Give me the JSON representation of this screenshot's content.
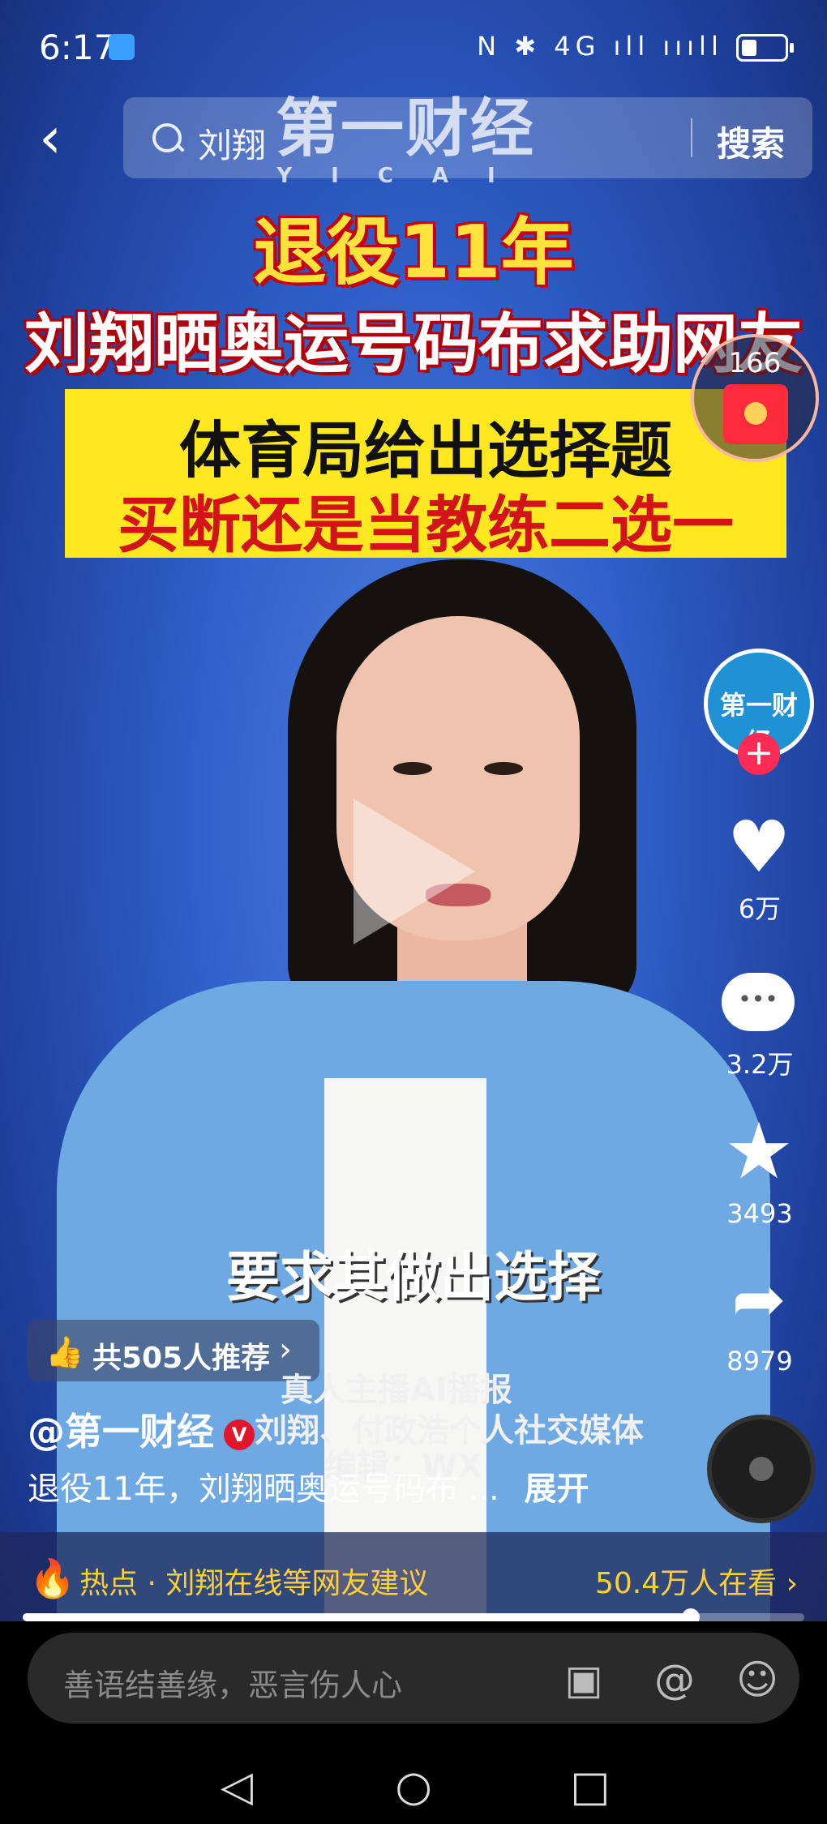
{
  "status_bar": {
    "time": "6:17",
    "icons_right": "N ✱ 4G ıll ıııll"
  },
  "search": {
    "query": "刘翔",
    "button": "搜索"
  },
  "watermark": {
    "brand": "第一财经",
    "latin": "YICAI"
  },
  "video": {
    "headline_line1": "退役11年",
    "headline_line2": "刘翔晒奥运号码布求助网友",
    "box_line1": "体育局给出选择题",
    "box_line2": "买断还是当教练二选一",
    "subtitle": "要求其做出选择",
    "overlay_ai": "真人主播AI播报",
    "overlay_author": "刘翔、付政浩个人社交媒体",
    "overlay_editor": "编辑：WX"
  },
  "red_packet": {
    "count": "166"
  },
  "actions": {
    "avatar_text": "第一财经",
    "follow": "+",
    "likes": "6万",
    "comments": "3.2万",
    "favorites": "3493",
    "shares": "8979"
  },
  "recommend": {
    "text": "共505人推荐",
    "chevron": "›"
  },
  "author": {
    "name": "@第一财经",
    "badge": "V"
  },
  "description": {
    "text": "退役11年，刘翔晒奥运号码布 ...",
    "more": "展开"
  },
  "hot": {
    "text": "热点 · 刘翔在线等网友建议",
    "viewers": "50.4万人在看 ›"
  },
  "progress": {
    "fraction": 0.855
  },
  "comment_input": {
    "placeholder": "善语结善缘，恶言伤人心"
  },
  "icons": {
    "image": "image-icon",
    "mention": "@",
    "emoji": "emoji-icon"
  },
  "nav": {
    "back": "◁",
    "home": "○",
    "recent": "□"
  }
}
